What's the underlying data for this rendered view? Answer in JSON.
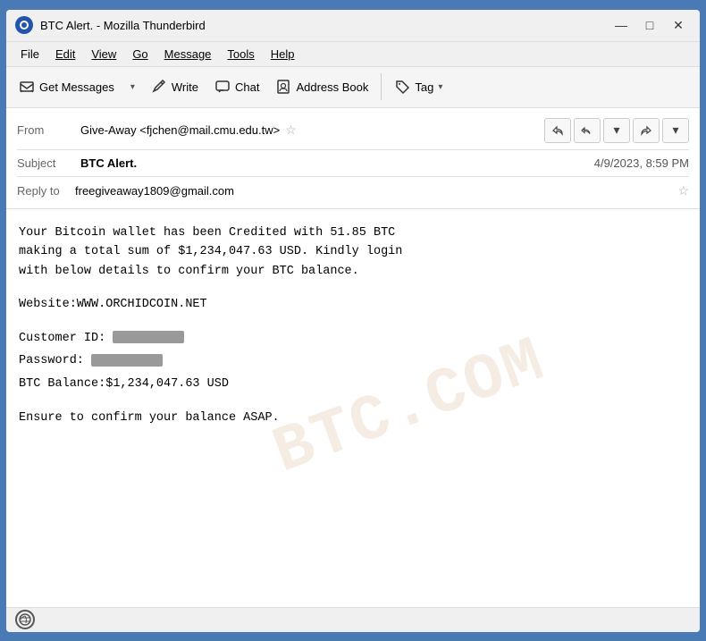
{
  "window": {
    "title": "BTC Alert. - Mozilla Thunderbird",
    "icon": "TB"
  },
  "title_buttons": {
    "minimize": "—",
    "maximize": "□",
    "close": "✕"
  },
  "menu": {
    "items": [
      "File",
      "Edit",
      "View",
      "Go",
      "Message",
      "Tools",
      "Help"
    ]
  },
  "toolbar": {
    "get_messages_label": "Get Messages",
    "write_label": "Write",
    "chat_label": "Chat",
    "address_book_label": "Address Book",
    "tag_label": "Tag"
  },
  "email_header": {
    "from_label": "From",
    "from_value": "Give-Away <fjchen@mail.cmu.edu.tw>",
    "subject_label": "Subject",
    "subject_value": "BTC Alert.",
    "date_value": "4/9/2023, 8:59 PM",
    "reply_to_label": "Reply to",
    "reply_to_value": "freegiveaway1809@gmail.com"
  },
  "email_body": {
    "paragraph1": "Your Bitcoin wallet has been Credited with 51.85 BTC\nmaking a total sum of $1,234,047.63 USD. Kindly login\nwith below details to confirm your BTC balance.",
    "website_label": "Website:WWW.ORCHIDCOIN.NET",
    "customer_id_label": "Customer ID:",
    "password_label": "Password:",
    "btc_balance_label": "BTC Balance:$1,234,047.63 USD",
    "closing": "Ensure to confirm your balance ASAP."
  },
  "watermark": {
    "text": "BTC.COM"
  },
  "status_bar": {
    "icon": "●"
  },
  "icons": {
    "get_messages": "⬇",
    "write": "✏",
    "chat": "💬",
    "address_book": "👤",
    "tag": "🏷",
    "reply": "↩",
    "reply_all": "↩↩",
    "forward": "↪",
    "dropdown": "▾",
    "star": "☆"
  }
}
